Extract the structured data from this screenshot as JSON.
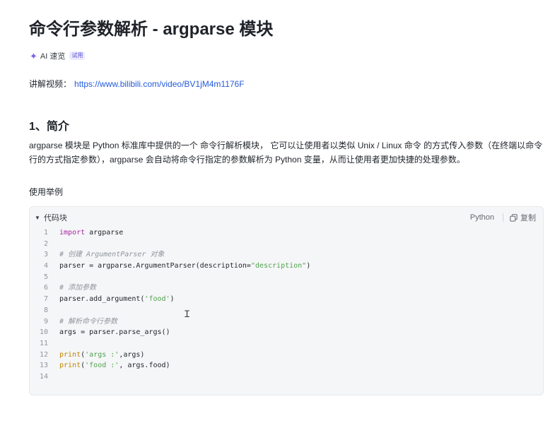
{
  "document": {
    "title": "命令行参数解析 - argparse 模块",
    "ai_overview": {
      "label": "AI 速览",
      "badge": "试用"
    },
    "video": {
      "label": "讲解视频：",
      "url": "https://www.bilibili.com/video/BV1jM4m1176F"
    },
    "section1": {
      "heading": "1、简介",
      "paragraph": "argparse 模块是 Python 标准库中提供的一个 命令行解析模块， 它可以让使用者以类似 Unix / Linux 命令 的方式传入参数（在终端以命令行的方式指定参数），argparse 会自动将命令行指定的参数解析为 Python 变量，从而让使用者更加快捷的处理参数。"
    },
    "usage_heading": "使用举例"
  },
  "code_block": {
    "toggle_label": "代码块",
    "language": "Python",
    "copy_label": "复制",
    "lines": [
      {
        "n": "1",
        "tokens": [
          {
            "t": "kw",
            "v": "import"
          },
          {
            "t": "tx",
            "v": " argparse"
          }
        ]
      },
      {
        "n": "2",
        "tokens": []
      },
      {
        "n": "3",
        "tokens": [
          {
            "t": "cm",
            "v": "# 创建 ArgumentParser 对象"
          }
        ]
      },
      {
        "n": "4",
        "tokens": [
          {
            "t": "tx",
            "v": "parser = argparse.ArgumentParser(description="
          },
          {
            "t": "st",
            "v": "\"description\""
          },
          {
            "t": "tx",
            "v": ")"
          }
        ]
      },
      {
        "n": "5",
        "tokens": []
      },
      {
        "n": "6",
        "tokens": [
          {
            "t": "cm",
            "v": "# 添加参数"
          }
        ]
      },
      {
        "n": "7",
        "tokens": [
          {
            "t": "tx",
            "v": "parser.add_argument("
          },
          {
            "t": "st",
            "v": "'food'"
          },
          {
            "t": "tx",
            "v": ")"
          }
        ]
      },
      {
        "n": "8",
        "tokens": []
      },
      {
        "n": "9",
        "tokens": [
          {
            "t": "cm",
            "v": "# 解析命令行参数"
          }
        ]
      },
      {
        "n": "10",
        "tokens": [
          {
            "t": "tx",
            "v": "args = parser.parse_args()"
          }
        ]
      },
      {
        "n": "11",
        "tokens": []
      },
      {
        "n": "12",
        "tokens": [
          {
            "t": "fn",
            "v": "print"
          },
          {
            "t": "tx",
            "v": "("
          },
          {
            "t": "st",
            "v": "'args :'"
          },
          {
            "t": "tx",
            "v": ",args)"
          }
        ]
      },
      {
        "n": "13",
        "tokens": [
          {
            "t": "fn",
            "v": "print"
          },
          {
            "t": "tx",
            "v": "("
          },
          {
            "t": "st",
            "v": "'food :'"
          },
          {
            "t": "tx",
            "v": ", args.food)"
          }
        ]
      },
      {
        "n": "14",
        "tokens": []
      }
    ]
  },
  "icons": {
    "ai": "sparkle-icon",
    "toggle": "triangle-down-icon",
    "copy": "copy-icon",
    "cursor": "text-cursor-icon"
  },
  "colors": {
    "link": "#245bdb",
    "keyword": "#a626a4",
    "string": "#50a14f",
    "builtin": "#c18401",
    "comment": "#8f959e",
    "ai_accent": "#7b5cf0"
  }
}
